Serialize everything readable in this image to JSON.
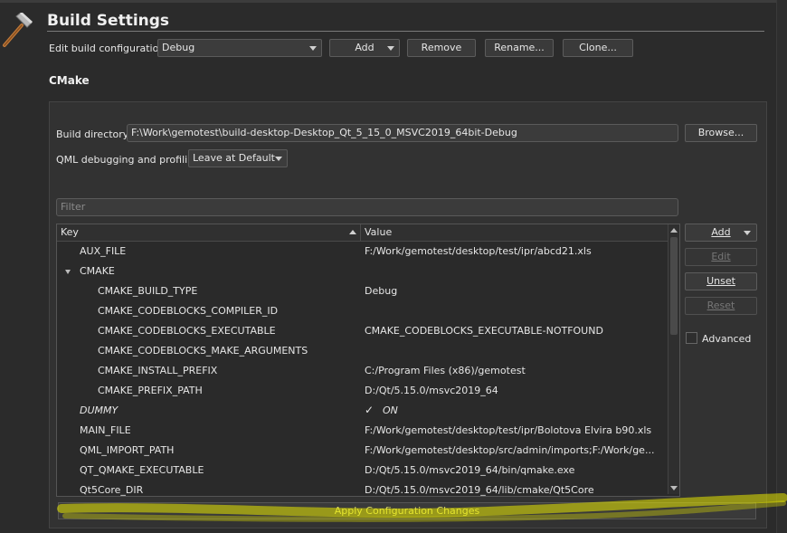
{
  "title": "Build Settings",
  "edit_config": {
    "label": "Edit build configuration:",
    "value": "Debug",
    "add_label": "Add",
    "remove_label": "Remove",
    "rename_label": "Rename...",
    "clone_label": "Clone..."
  },
  "section_title": "CMake",
  "build_directory": {
    "label": "Build directory:",
    "value": "F:\\Work\\gemotest\\build-desktop-Desktop_Qt_5_15_0_MSVC2019_64bit-Debug",
    "browse_label": "Browse..."
  },
  "qml_debugging": {
    "label": "QML debugging and profiling:",
    "value": "Leave at Default"
  },
  "filter": {
    "placeholder": "Filter"
  },
  "table": {
    "headers": [
      "Key",
      "Value"
    ],
    "rows": [
      {
        "key": "AUX_FILE",
        "value": "F:/Work/gemotest/desktop/test/ipr/abcd21.xls",
        "level": 1
      },
      {
        "key": "CMAKE",
        "value": "",
        "level": 1,
        "expanded": true
      },
      {
        "key": "CMAKE_BUILD_TYPE",
        "value": "Debug",
        "level": 2
      },
      {
        "key": "CMAKE_CODEBLOCKS_COMPILER_ID",
        "value": "",
        "level": 2
      },
      {
        "key": "CMAKE_CODEBLOCKS_EXECUTABLE",
        "value": "CMAKE_CODEBLOCKS_EXECUTABLE-NOTFOUND",
        "level": 2
      },
      {
        "key": "CMAKE_CODEBLOCKS_MAKE_ARGUMENTS",
        "value": "",
        "level": 2
      },
      {
        "key": "CMAKE_INSTALL_PREFIX",
        "value": "C:/Program Files (x86)/gemotest",
        "level": 2
      },
      {
        "key": "CMAKE_PREFIX_PATH",
        "value": "D:/Qt/5.15.0/msvc2019_64",
        "level": 2
      },
      {
        "key": "DUMMY",
        "value": "ON",
        "level": 1,
        "italic": true,
        "checked": true
      },
      {
        "key": "MAIN_FILE",
        "value": "F:/Work/gemotest/desktop/test/ipr/Bolotova Elvira b90.xls",
        "level": 1
      },
      {
        "key": "QML_IMPORT_PATH",
        "value": "F:/Work/gemotest/desktop/src/admin/imports;F:/Work/ge...",
        "level": 1
      },
      {
        "key": "QT_QMAKE_EXECUTABLE",
        "value": "D:/Qt/5.15.0/msvc2019_64/bin/qmake.exe",
        "level": 1
      },
      {
        "key": "Qt5Core_DIR",
        "value": "D:/Qt/5.15.0/msvc2019_64/lib/cmake/Qt5Core",
        "level": 1
      }
    ]
  },
  "side_buttons": {
    "add": "Add",
    "edit": "Edit",
    "unset": "Unset",
    "reset": "Reset",
    "advanced": "Advanced"
  },
  "apply_label": "Apply Configuration Changes",
  "colors": {
    "background": "#2b2b2b",
    "panel": "#323232",
    "text": "#e6e6e6",
    "highlight": "#e8e800"
  }
}
